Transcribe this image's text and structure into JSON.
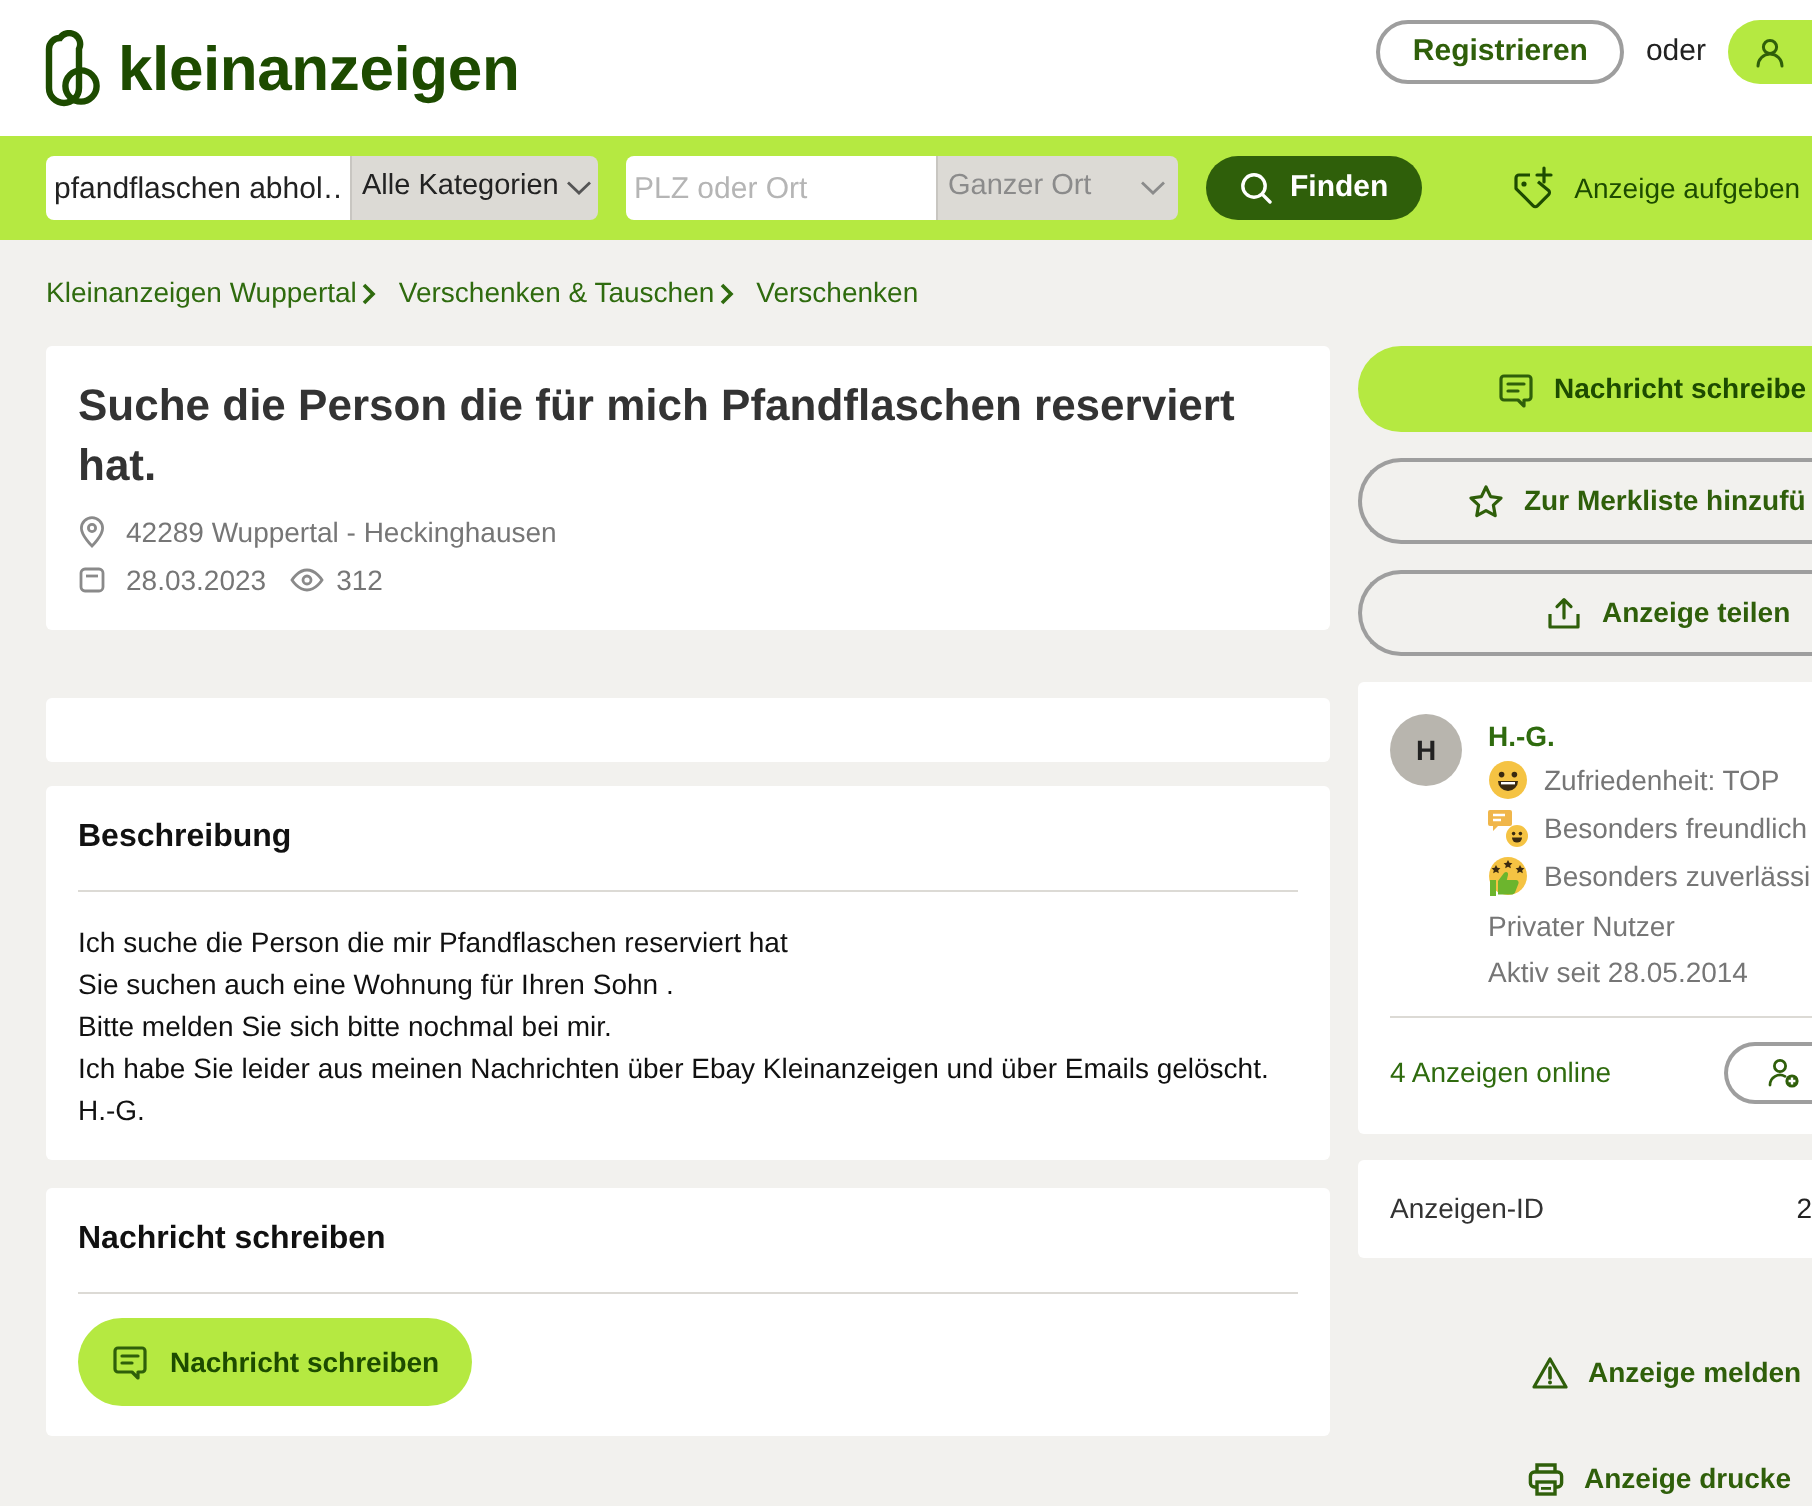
{
  "header": {
    "logo": "kleinanzeigen",
    "register_button": "Registrieren",
    "or_text": "oder"
  },
  "search_bar": {
    "query": "pfandflaschen abhol…",
    "category": "Alle Kategorien",
    "location_placeholder": "PLZ oder Ort",
    "radius": "Ganzer Ort",
    "radius_disabled": true,
    "search_button": "Finden",
    "post_ad": "Anzeige aufgeben"
  },
  "breadcrumbs": [
    "Kleinanzeigen Wuppertal",
    "Verschenken & Tauschen",
    "Verschenken"
  ],
  "ad": {
    "title": "Suche die Person die für mich Pfandflaschen reserviert hat.",
    "location": "42289 Wuppertal - Heckinghausen",
    "date": "28.03.2023",
    "views": "312"
  },
  "description": {
    "heading": "Beschreibung",
    "lines": [
      "Ich suche die Person die mir Pfandflaschen reserviert hat",
      "Sie suchen auch eine Wohnung für Ihren Sohn .",
      "Bitte melden Sie sich bitte nochmal bei mir.",
      "Ich habe Sie leider aus meinen Nachrichten über Ebay Kleinanzeigen und über Emails gelöscht.",
      "H.-G."
    ]
  },
  "contact": {
    "heading": "Nachricht schreiben",
    "button": "Nachricht schreiben"
  },
  "side_actions": [
    {
      "label": "Nachricht schreibe",
      "kind": "message"
    },
    {
      "label": "Zur Merkliste hinzufü",
      "kind": "watchlist"
    },
    {
      "label": "Anzeige teilen",
      "kind": "share"
    }
  ],
  "seller": {
    "initial": "H",
    "name": "H.-G.",
    "badges": [
      {
        "label": "Zufriedenheit: TOP",
        "kind": "smile"
      },
      {
        "label": "Besonders freundlich",
        "kind": "friendly"
      },
      {
        "label": "Besonders zuverlässi",
        "kind": "reliable"
      }
    ],
    "type": "Privater Nutzer",
    "active_since": "Aktiv seit 28.05.2014",
    "ads_online": "4 Anzeigen online"
  },
  "ad_id": {
    "label": "Anzeigen-ID",
    "value": "2"
  },
  "footer_links": [
    {
      "label": "Anzeige melden",
      "kind": "report"
    },
    {
      "label": "Anzeige drucke",
      "kind": "print"
    }
  ]
}
